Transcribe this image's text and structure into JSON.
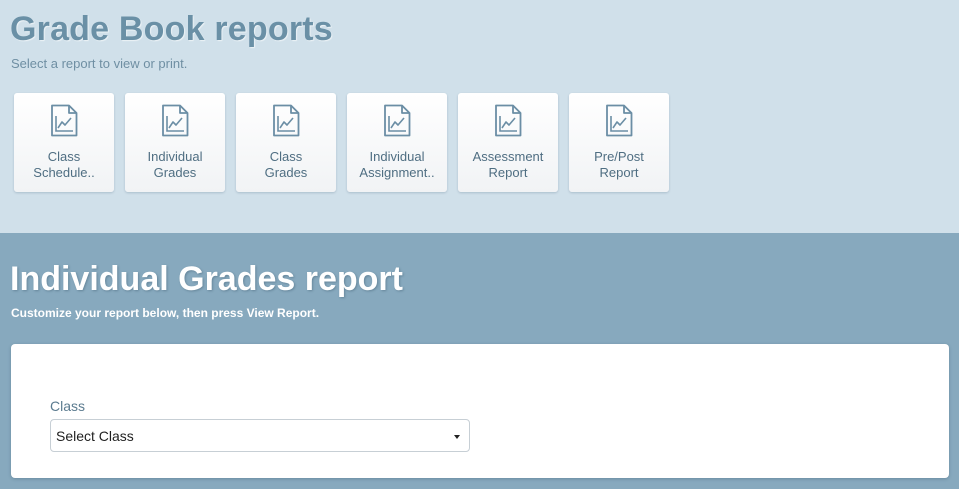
{
  "header": {
    "title": "Grade Book reports",
    "subtitle": "Select a report to view or print."
  },
  "reports": [
    {
      "line1": "Class",
      "line2": "Schedule..",
      "icon": "chart-document-icon"
    },
    {
      "line1": "Individual",
      "line2": "Grades",
      "icon": "chart-document-icon"
    },
    {
      "line1": "Class",
      "line2": "Grades",
      "icon": "chart-document-icon"
    },
    {
      "line1": "Individual",
      "line2": "Assignment..",
      "icon": "chart-document-icon"
    },
    {
      "line1": "Assessment",
      "line2": "Report",
      "icon": "chart-document-icon"
    },
    {
      "line1": "Pre/Post",
      "line2": "Report",
      "icon": "chart-document-icon"
    }
  ],
  "report": {
    "title": "Individual Grades report",
    "subtitle": "Customize your report below, then press View Report."
  },
  "form": {
    "class_label": "Class",
    "class_value": "Select Class"
  },
  "colors": {
    "top_background": "#d0e0ea",
    "bottom_background": "#87a9be",
    "title_color": "#6a90a6",
    "icon_color": "#6b8ea5"
  }
}
